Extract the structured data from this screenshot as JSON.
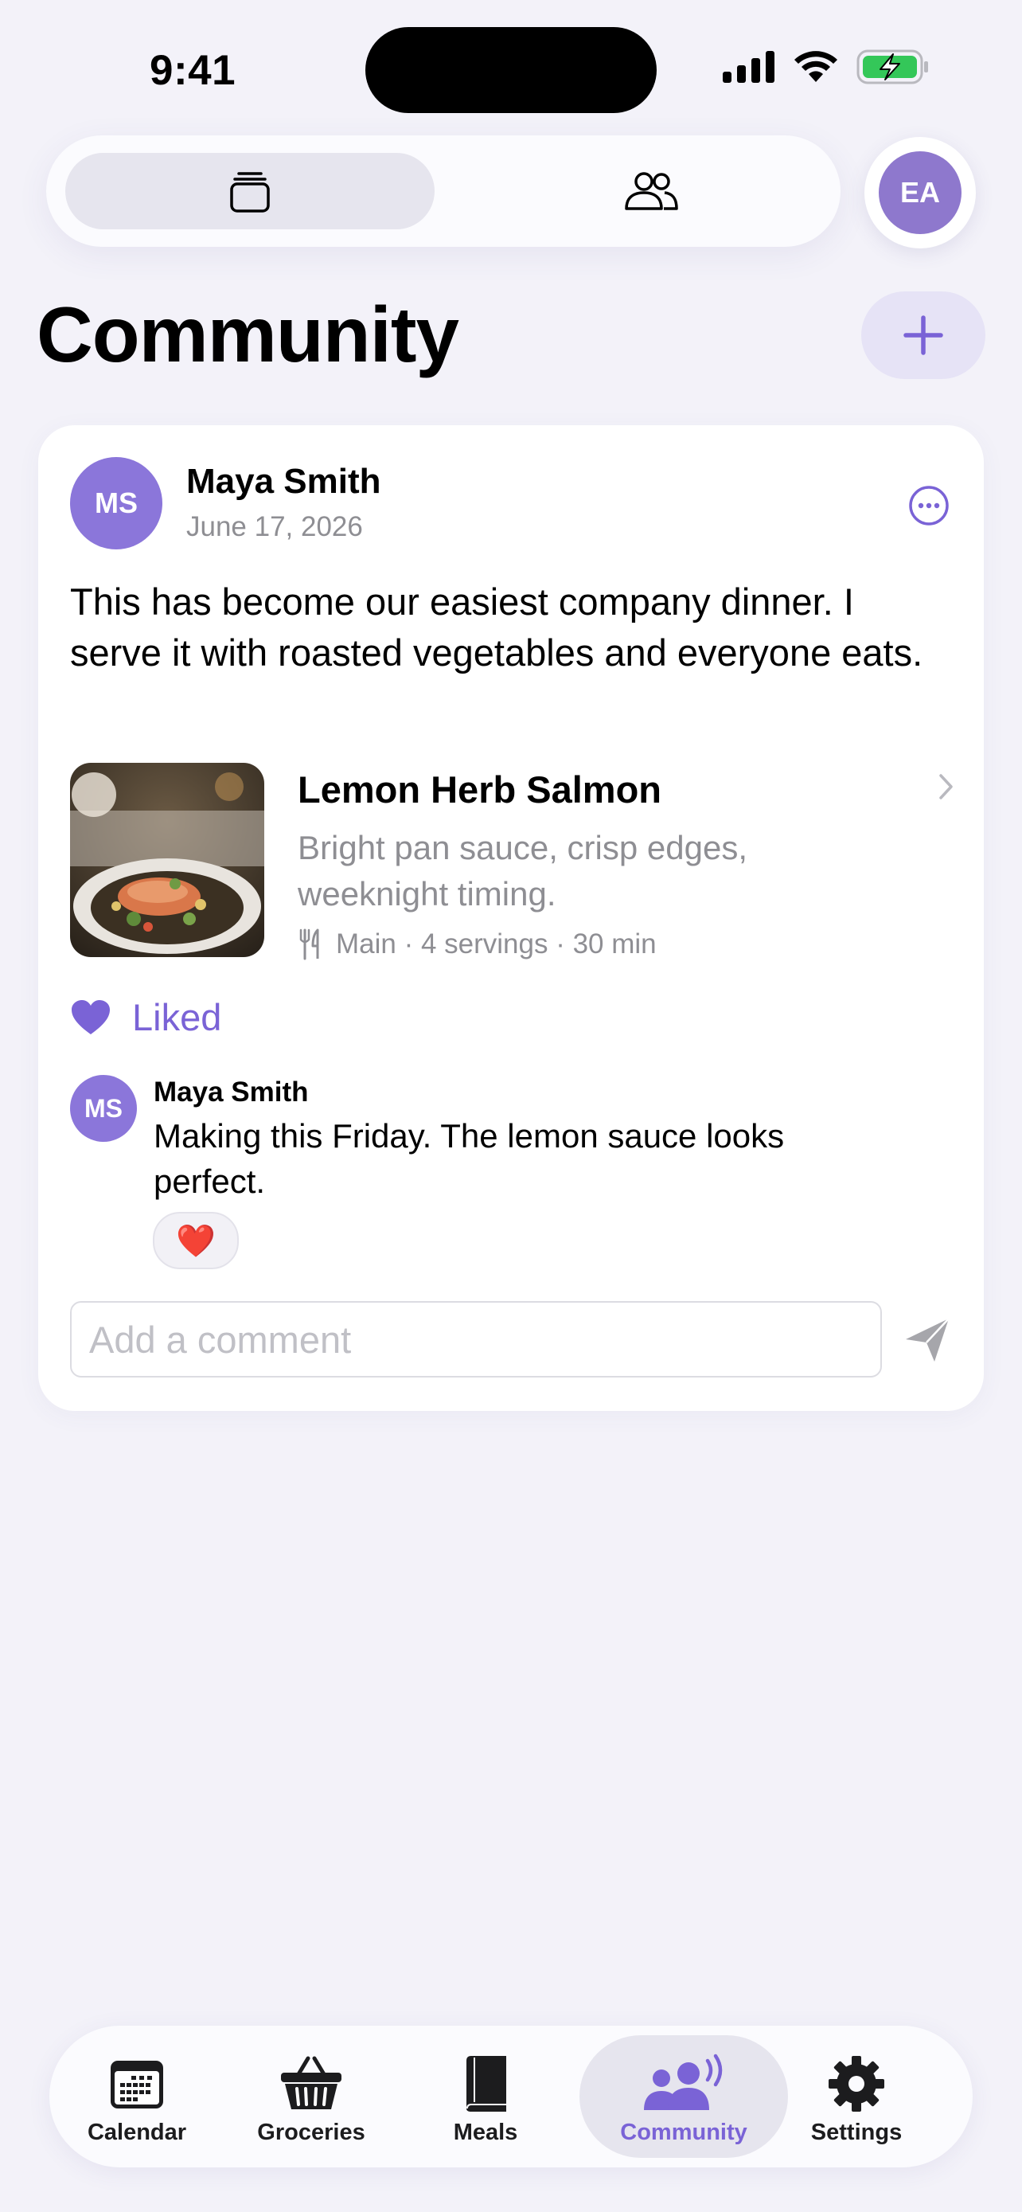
{
  "status_bar": {
    "time": "9:41"
  },
  "top_segment": {
    "avatar_initials": "EA"
  },
  "header": {
    "title": "Community"
  },
  "post": {
    "author_initials": "MS",
    "author": "Maya Smith",
    "date": "June 17, 2026",
    "body": "This has become our easiest company dinner. I serve it with roasted vegetables and everyone eats.",
    "recipe": {
      "title": "Lemon Herb Salmon",
      "description": "Bright pan sauce, crisp edges, weeknight timing.",
      "meta": "Main · 4 servings · 30 min"
    },
    "like_label": "Liked",
    "comment": {
      "author_initials": "MS",
      "author": "Maya Smith",
      "text": "Making this Friday. The lemon sauce looks perfect.",
      "reaction": "❤️"
    },
    "comment_placeholder": "Add a comment"
  },
  "tabbar": {
    "tabs": [
      {
        "label": "Calendar",
        "icon": "calendar-icon"
      },
      {
        "label": "Groceries",
        "icon": "basket-icon"
      },
      {
        "label": "Meals",
        "icon": "book-icon"
      },
      {
        "label": "Community",
        "icon": "community-icon",
        "active": true
      },
      {
        "label": "Settings",
        "icon": "gear-icon"
      }
    ]
  },
  "colors": {
    "accent": "#7a63d6",
    "background": "#f3f2f9",
    "avatar": "#8b76da"
  }
}
